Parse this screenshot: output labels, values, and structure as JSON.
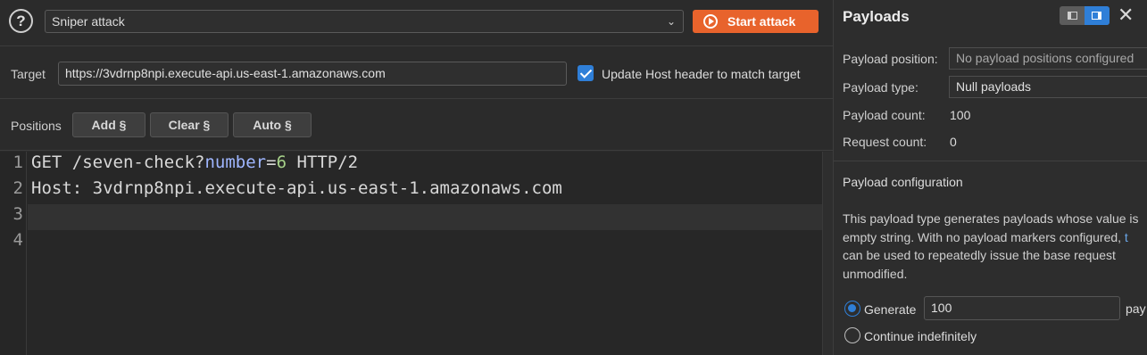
{
  "attack_bar": {
    "help_icon": "question-circle-icon",
    "attack_type": "Sniper attack",
    "start_button": "Start attack"
  },
  "target": {
    "label": "Target",
    "url": "https://3vdrnp8npi.execute-api.us-east-1.amazonaws.com",
    "update_host_checked": true,
    "update_host_label": "Update Host header to match target"
  },
  "positions": {
    "label": "Positions",
    "add_button": "Add §",
    "clear_button": "Clear §",
    "auto_button": "Auto §"
  },
  "editor": {
    "line_numbers": [
      "1",
      "2",
      "3",
      "4"
    ],
    "line1": {
      "method_path": "GET /seven-check?",
      "param": "number",
      "eq": "=",
      "value": "6",
      "proto": " HTTP/2"
    },
    "line2": "Host: 3vdrnp8npi.execute-api.us-east-1.amazonaws.com",
    "line3": "",
    "line4": ""
  },
  "payloads_panel": {
    "title": "Payloads",
    "payload_position_label": "Payload position:",
    "payload_position_value": "No payload positions configured",
    "payload_type_label": "Payload type:",
    "payload_type_value": "Null payloads",
    "payload_count_label": "Payload count:",
    "payload_count_value": "100",
    "request_count_label": "Request count:",
    "request_count_value": "0",
    "config_title": "Payload configuration",
    "description": {
      "line1": "This payload type generates payloads whose value is",
      "line2_pre": "empty string. With no payload markers configured, ",
      "line2_link": "t",
      "line3": "can be used to repeatedly issue the base request",
      "line4": "unmodified."
    },
    "generate_label": "Generate",
    "generate_value": "100",
    "generate_suffix": "pay",
    "continue_label": "Continue indefinitely"
  },
  "colors": {
    "accent": "#2f7fd8",
    "start_button": "#e8632c",
    "background": "#2b2b2b"
  }
}
